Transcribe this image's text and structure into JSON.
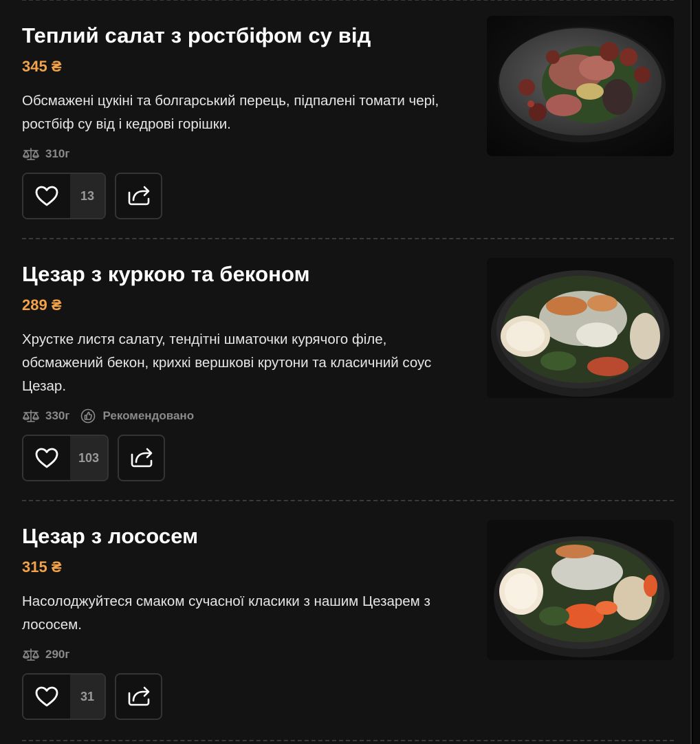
{
  "weight_icon": "scale-icon",
  "recommended_icon": "thumb-icon",
  "like_icon": "heart-icon",
  "share_icon": "share-icon",
  "colors": {
    "background": "#131313",
    "price": "#f2a34a",
    "muted": "#8a8a8a",
    "border": "#343434"
  },
  "items": [
    {
      "title": "Теплий салат з ростбіфом су від",
      "price": "345 ₴",
      "description": "Обсмажені цукіні та болгарський перець, підпалені томати чері, ростбіф су від і кедрові горішки.",
      "weight": "310г",
      "likes": "13"
    },
    {
      "title": "Цезар з куркою та беконом",
      "price": "289 ₴",
      "description": "Хрустке листя салату, тендітні шматочки курячого філе, обсмажений бекон, крихкі вершкові крутони та класичний соус Цезар.",
      "weight": "330г",
      "badge": "Рекомендовано",
      "likes": "103"
    },
    {
      "title": "Цезар з лососем",
      "price": "315 ₴",
      "description": "Насолоджуйтеся смаком сучасної класики з нашим Цезарем з лососем.",
      "weight": "290г",
      "likes": "31"
    }
  ]
}
